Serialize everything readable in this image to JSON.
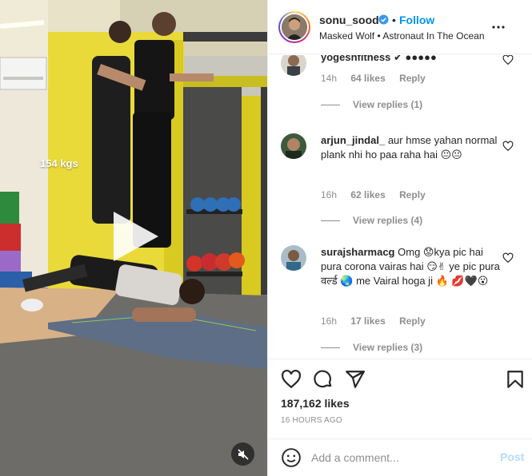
{
  "post": {
    "overlay_text": "154 kgs",
    "media_type": "video"
  },
  "header": {
    "username": "sonu_sood",
    "separator": "•",
    "follow_label": "Follow",
    "subtitle": "Masked Wolf • Astronaut In The Ocean"
  },
  "comments": [
    {
      "username": "yogeshfitness",
      "text": "✔ ●●●●●",
      "time": "14h",
      "likes": "64 likes",
      "reply_label": "Reply",
      "view_replies": "View replies (1)"
    },
    {
      "username": "arjun_jindal_",
      "text": "aur hmse yahan normal plank nhi ho paa raha hai 😐😐",
      "time": "16h",
      "likes": "62 likes",
      "reply_label": "Reply",
      "view_replies": "View replies (4)"
    },
    {
      "username": "surajsharmacg",
      "text": "Omg 😟kya pic hai pura corona vairas hai 😏✌ ye pic pura वर्ल्ड 🌏 me Vairal hoga ji 🔥 💋🖤😮",
      "time": "16h",
      "likes": "17 likes",
      "reply_label": "Reply",
      "view_replies": "View replies (3)"
    }
  ],
  "actions": {
    "likes_count": "187,162 likes",
    "time_ago": "16 HOURS AGO"
  },
  "composer": {
    "placeholder": "Add a comment...",
    "post_label": "Post"
  },
  "colors": {
    "accent": "#0095f6",
    "post_disabled": "#b3dbff",
    "muted": "#8e8e8e",
    "gym_yellow": "#e6d52a"
  },
  "icons": [
    "verified-badge-icon",
    "more-options-icon",
    "heart-icon",
    "comment-icon",
    "share-icon",
    "bookmark-icon",
    "emoji-icon",
    "play-icon",
    "mute-icon"
  ]
}
